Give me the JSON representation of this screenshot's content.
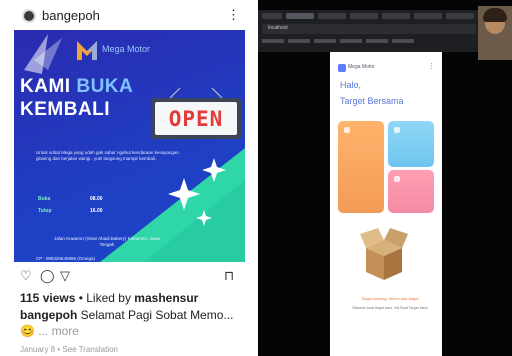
{
  "instagram": {
    "username": "bangepoh",
    "more_icon": "vertical-ellipsis-icon",
    "post": {
      "brand_name": "Mega Motor",
      "headline_part1": "KAMI",
      "headline_part2": "BUKA",
      "headline_line2": "KEMBALI",
      "sign_text": "OPEN",
      "body_text": "Untuk sobat Mega yang udah gak sabar ngebut kendaraan kesayangan glowing dan berjalan wangi.. yuk! langsung mampir kembali..",
      "hours": [
        {
          "label": "Buka",
          "value": "08.00"
        },
        {
          "label": "Tutup",
          "value": "16.00"
        }
      ],
      "address": "Jalan Kuwaron (Sinar Abadi Bakery) Kebumen, Jawa Tengah",
      "phone": "CP : 085326645996 (Omega)"
    },
    "actions": {
      "like_icon": "heart-icon",
      "comment_icon": "comment-icon",
      "share_icon": "send-icon",
      "save_icon": "bookmark-icon"
    },
    "views_count": "115 views",
    "liked_by_prefix": " • Liked by ",
    "liked_by_user": "mashensur",
    "caption_user": "bangepoh",
    "caption_text": " Selamat Pagi Sobat Memo...",
    "caption_emoji": "😊",
    "caption_more": "... more",
    "meta_line": "January 8 • See Translation"
  },
  "screen_share": {
    "url": "localhost",
    "app": {
      "logo_text": "Mega Motor",
      "greeting": "Halo,",
      "target_title": "Target Bersama",
      "empty_message": "Target kosong, belum ada target",
      "empty_link": "Silahkan buat target baru, klik Buat Target disini"
    },
    "colors": {
      "card_orange": "#f39a57",
      "card_blue": "#6fc5ef",
      "card_pink": "#f48aa4",
      "accent": "#5a78d6"
    }
  }
}
